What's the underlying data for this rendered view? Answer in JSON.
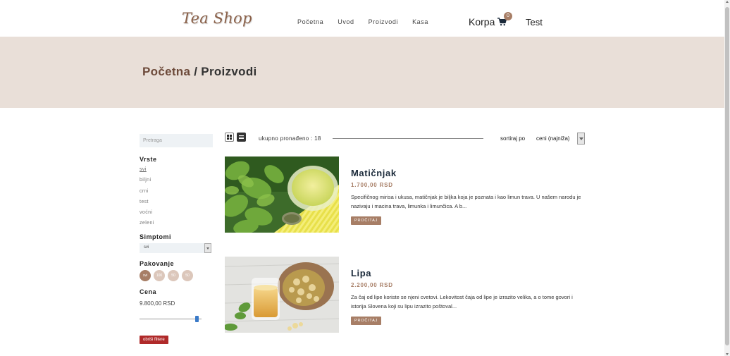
{
  "brand": {
    "logo": "Tea Shop",
    "accent": "#a77e66",
    "hero_bg": "#e9dfd8"
  },
  "nav": {
    "items": [
      "Početna",
      "Uvod",
      "Proizvodi",
      "Kasa"
    ]
  },
  "header": {
    "cart_label": "Korpa",
    "cart_icon": "cart-icon",
    "cart_count": "0",
    "user_name": "Test"
  },
  "breadcrumb": {
    "home": "Početna",
    "current": "/ Proizvodi"
  },
  "sidebar": {
    "search_placeholder": "Pretraga",
    "types_title": "Vrste",
    "types": [
      "svi",
      "biljni",
      "crni",
      "test",
      "voćni",
      "zeleni"
    ],
    "active_type": "svi",
    "symptoms_title": "Simptomi",
    "symptoms_selected": "svi",
    "packaging_title": "Pakovanje",
    "packaging_options": [
      "svi",
      "100",
      "50",
      "50"
    ],
    "price_title": "Cena",
    "price_value": "9.800,00 RSD",
    "price_slider_fraction": 0.95,
    "clear_button": "obriši filtere"
  },
  "toolbar": {
    "count_text": "ukupno pronađeno : 18",
    "sort_label": "sortiraj po",
    "sort_selected": "ceni (najniža)",
    "view_modes": [
      "grid-icon",
      "list-icon"
    ]
  },
  "products": [
    {
      "name": "Matičnjak",
      "price": "1.700,00 RSD",
      "description": "Specifičnog mirisa i ukusa, matičnjak je biljka koja je poznata i kao limun trava. U našem narodu je nazivaju i macina trava, limunka i limunčica. A b...",
      "button": "PROČITAJ"
    },
    {
      "name": "Lipa",
      "price": "2.200,00 RSD",
      "description": "Za čaj od lipe koriste se njeni cvetovi. Lekovitost čaja od lipe je izrazito velika, a o tome govori i istorija Slovena koji su lipu izrazito poštoval...",
      "button": "PROČITAJ"
    }
  ]
}
